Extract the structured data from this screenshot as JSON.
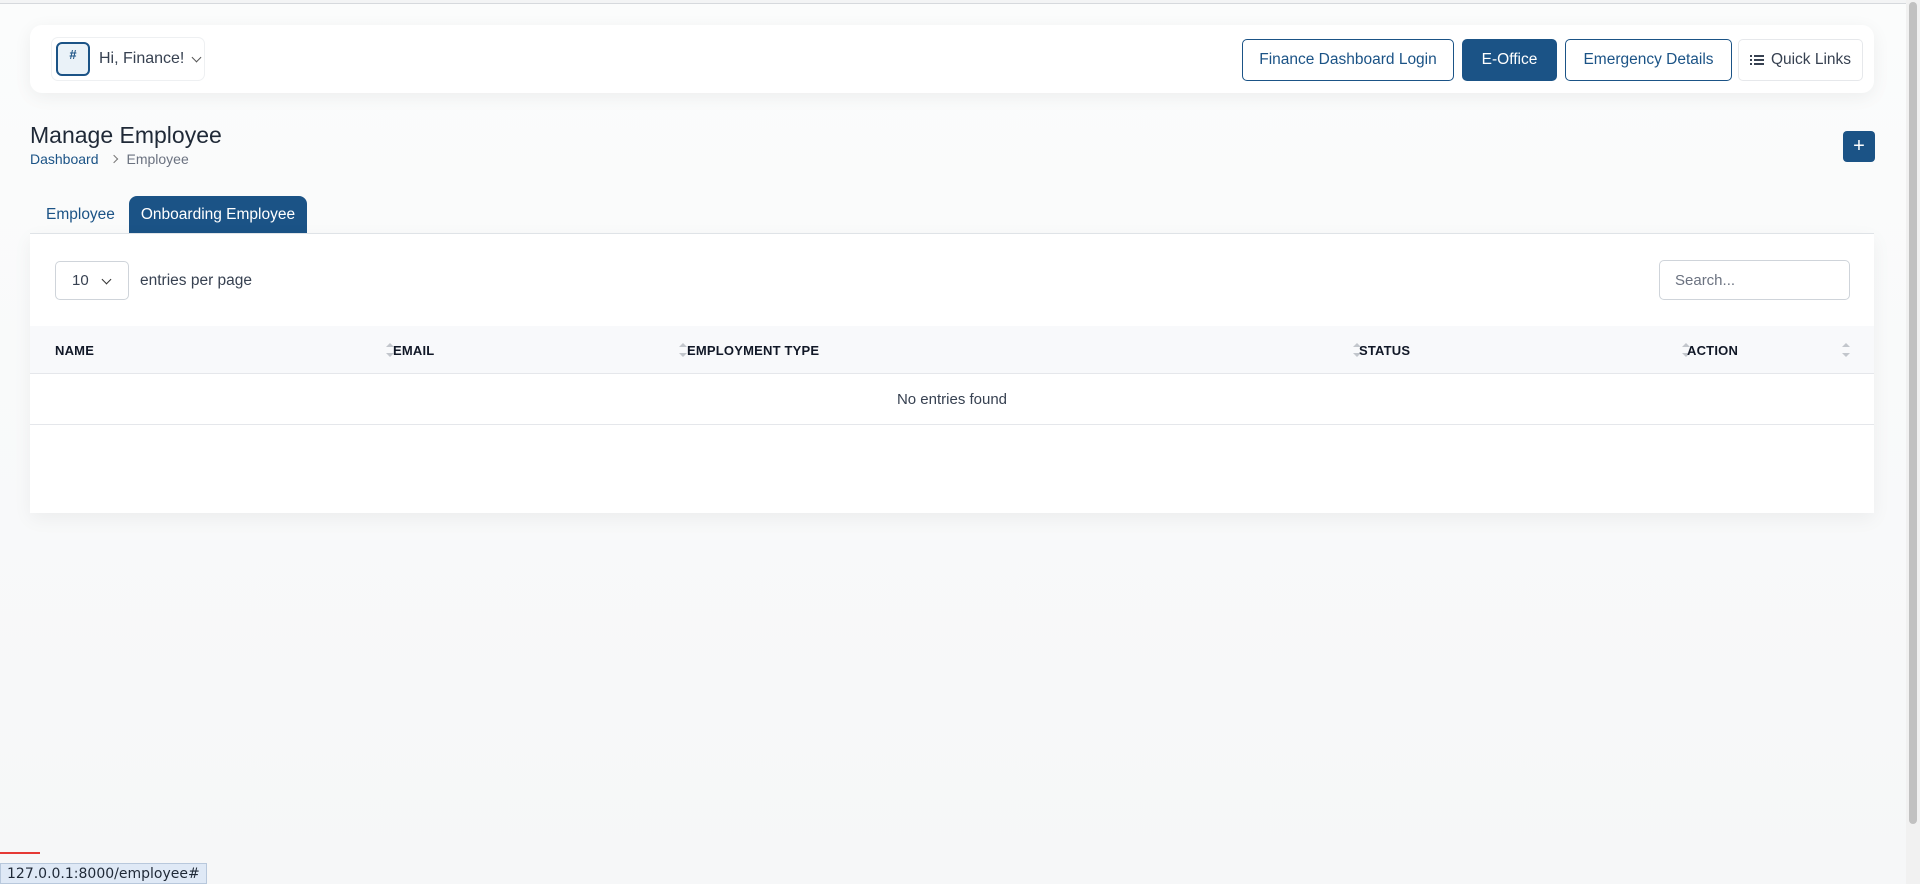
{
  "header": {
    "greeting": "Hi, Finance!",
    "avatar_alt": "#",
    "buttons": {
      "finance_login": "Finance Dashboard Login",
      "eoffice": "E-Office",
      "emergency": "Emergency Details",
      "quick_links": "Quick Links"
    }
  },
  "page": {
    "title": "Manage Employee",
    "breadcrumb": [
      "Dashboard",
      "Employee"
    ],
    "add_label": "+"
  },
  "tabs": [
    {
      "label": "Employee",
      "active": false
    },
    {
      "label": "Onboarding Employee",
      "active": true
    }
  ],
  "table": {
    "per_page_value": "10",
    "per_page_label": "entries per page",
    "search_placeholder": "Search...",
    "columns": [
      "NAME",
      "EMAIL",
      "EMPLOYMENT TYPE",
      "STATUS",
      "ACTION"
    ],
    "empty_message": "No entries found"
  },
  "status_bar": {
    "url": "127.0.0.1:8000/employee#"
  },
  "colors": {
    "primary": "#1b5386",
    "background": "#f6f7f8"
  },
  "icons": [
    "user-avatar-icon",
    "chevron-down-icon",
    "list-icon",
    "chevron-right-icon",
    "sort-icon",
    "plus-icon"
  ]
}
